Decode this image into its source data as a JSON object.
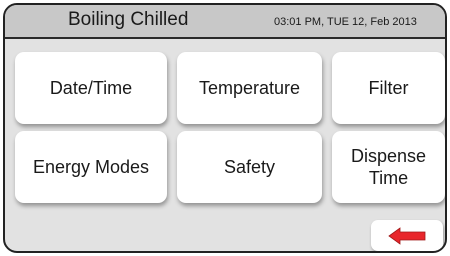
{
  "header": {
    "mode_label": "Boiling Chilled",
    "datetime": "03:01 PM, TUE 12, Feb 2013"
  },
  "menu": {
    "date_time": "Date/Time",
    "temperature": "Temperature",
    "filter": "Filter",
    "energy_modes": "Energy Modes",
    "safety": "Safety",
    "dispense_time": "Dispense\nTime"
  },
  "back_button": {
    "icon": "left-arrow-icon",
    "color": "#e8262b"
  }
}
